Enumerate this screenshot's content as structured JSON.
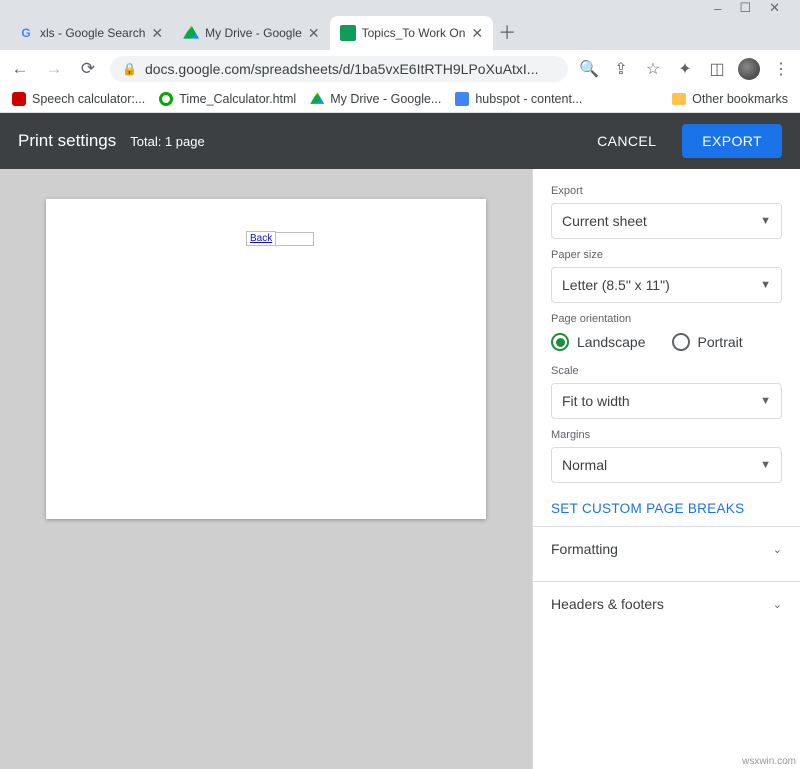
{
  "browser": {
    "tabs": [
      {
        "title": "xls - Google Search",
        "icon": "google"
      },
      {
        "title": "My Drive - Google",
        "icon": "drive"
      },
      {
        "title": "Topics_To Work On",
        "icon": "sheets",
        "active": true
      }
    ],
    "address": "docs.google.com/spreadsheets/d/1ba5vxE6ItRTH9LPoXuAtxI...",
    "bookmarks": [
      {
        "label": "Speech calculator:...",
        "icon": "red"
      },
      {
        "label": "Time_Calculator.html",
        "icon": "green"
      },
      {
        "label": "My Drive - Google...",
        "icon": "drive"
      },
      {
        "label": "hubspot - content...",
        "icon": "docs"
      }
    ],
    "other_bookmarks": "Other bookmarks"
  },
  "header": {
    "title": "Print settings",
    "total_label": "Total:",
    "total_value": "1 page",
    "cancel": "CANCEL",
    "export": "EXPORT"
  },
  "preview": {
    "cell_text": "Back"
  },
  "panel": {
    "export_label": "Export",
    "export_value": "Current sheet",
    "paper_label": "Paper size",
    "paper_value": "Letter (8.5\" x 11\")",
    "orient_label": "Page orientation",
    "orient_landscape": "Landscape",
    "orient_portrait": "Portrait",
    "scale_label": "Scale",
    "scale_value": "Fit to width",
    "margins_label": "Margins",
    "margins_value": "Normal",
    "custom_breaks": "SET CUSTOM PAGE BREAKS",
    "formatting": "Formatting",
    "headers_footers": "Headers & footers"
  },
  "watermark": "wsxwin.com"
}
